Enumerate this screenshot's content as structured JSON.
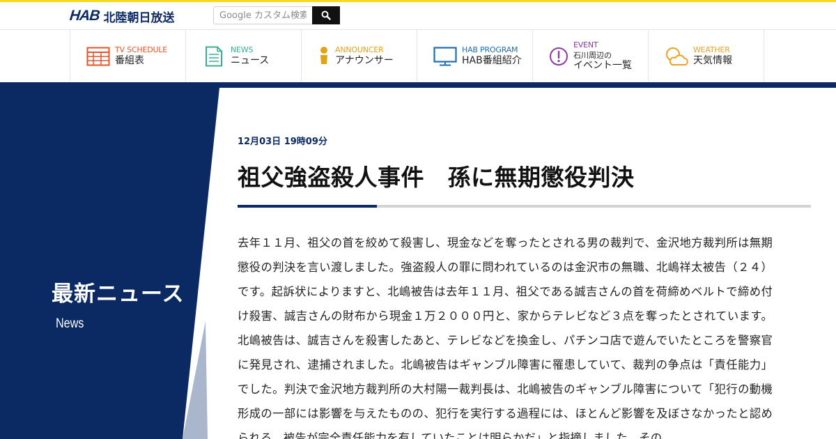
{
  "header": {
    "logo_text": "HAB",
    "logo_jp": "北陸朝日放送",
    "search_placeholder": "Google カスタム検索"
  },
  "nav": {
    "items": [
      {
        "en": "TV SCHEDULE",
        "jp": "番組表",
        "color": "#e0552a",
        "icon": "tv-schedule-icon"
      },
      {
        "en": "NEWS",
        "jp": "ニュース",
        "color": "#3aaf8f",
        "icon": "news-icon"
      },
      {
        "en": "ANNOUNCER",
        "jp": "アナウンサー",
        "color": "#e3a317",
        "icon": "announcer-icon"
      },
      {
        "en": "HAB PROGRAM",
        "jp": "HAB番組紹介",
        "color": "#1d6fb0",
        "icon": "tv-program-icon"
      },
      {
        "en": "EVENT",
        "jp1": "石川周辺の",
        "jp2": "イベント一覧",
        "color": "#8a3ca0",
        "icon": "event-icon"
      },
      {
        "en": "WEATHER",
        "jp": "天気情報",
        "color": "#e8a320",
        "icon": "weather-icon"
      }
    ]
  },
  "side": {
    "title": "最新ニュース",
    "subtitle": "News"
  },
  "article": {
    "date": "12月03日 19時09分",
    "title": "祖父強盗殺人事件　孫に無期懲役判決",
    "body": "去年１１月、祖父の首を絞めて殺害し、現金などを奪ったとされる男の裁判で、金沢地方裁判所は無期懲役の判決を言い渡しました。強盗殺人の罪に問われているのは金沢市の無職、北嶋祥太被告（２４）です。起訴状によりますと、北嶋被告は去年１１月、祖父である誠吉さんの首を荷締めベルトで締め付け殺害、誠吉さんの財布から現金１万２０００円と、家からテレビなど３点を奪ったとされています。北嶋被告は、誠吉さんを殺害したあと、テレビなどを換金し、パチンコ店で遊んでいたところを警察官に発見され、逮捕されました。北嶋被告はギャンブル障害に罹患していて、裁判の争点は「責任能力」でした。判決で金沢地方裁判所の大村陽一裁判長は、北嶋被告のギャンブル障害について「犯行の動機形成の一部には影響を与えたものの、犯行を実行する過程には、ほとんど影響を及ぼさなかったと認められる。被告が完全責任能力を有していたことは明らかだ」と指摘しました。その"
  },
  "colors": {
    "navy": "#0b2a63",
    "yellow": "#f4d91c",
    "stripe_light": "#a9b6cc"
  }
}
